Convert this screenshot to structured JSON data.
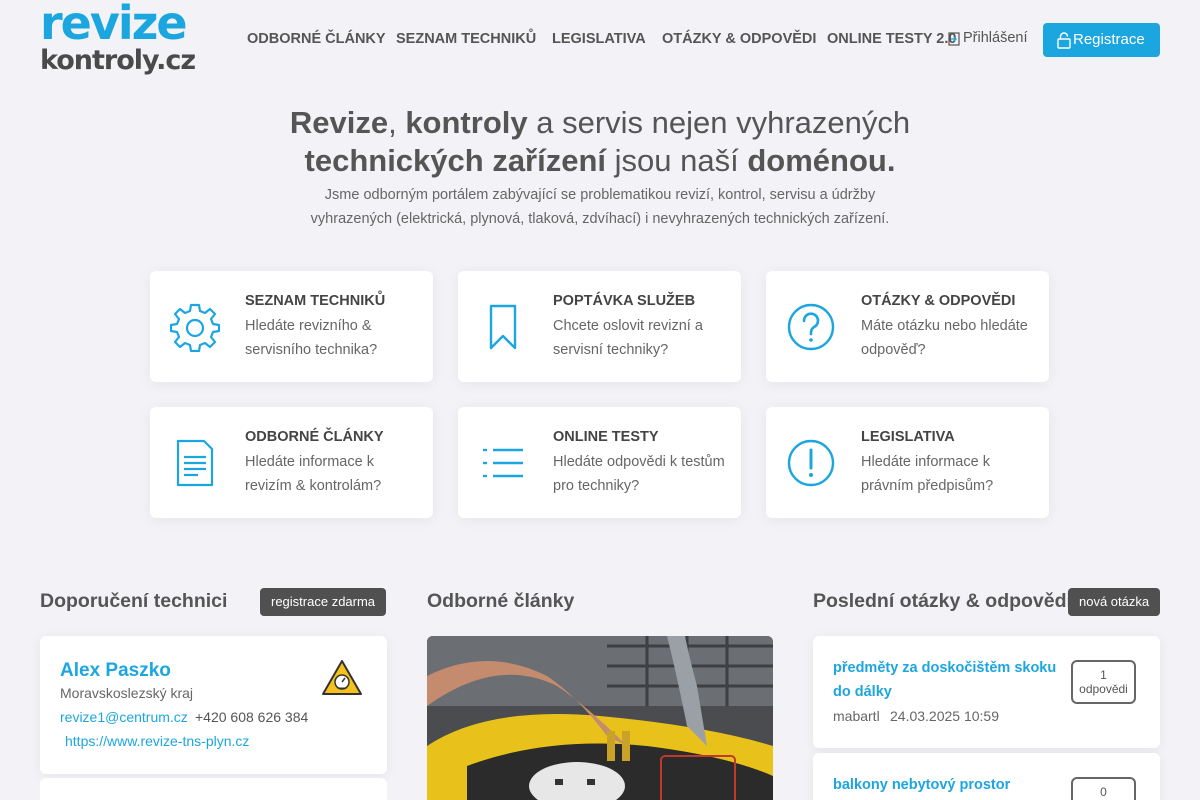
{
  "logo": {
    "line1": "revize",
    "line2": "kontroly.cz"
  },
  "nav": {
    "items": [
      {
        "label": "ODBORNÉ ČLÁNKY"
      },
      {
        "label": "SEZNAM TECHNIKŮ"
      },
      {
        "label": "LEGISLATIVA"
      },
      {
        "label": "OTÁZKY & ODPOVĚDI"
      },
      {
        "label": "ONLINE TESTY 2.0"
      }
    ],
    "login": "Přihlášení",
    "register": "Registrace"
  },
  "hero": {
    "title_parts": [
      "Revize",
      ", ",
      "kontroly",
      " a servis nejen vyhrazených",
      "technických zařízení",
      " jsou naší ",
      "doménou",
      "."
    ],
    "subtitle": "Jsme odborným portálem zabývající se problematikou revizí, kontrol, servisu a údržby vyhrazených (elektrická, plynová, tlaková, zdvíhací) i nevyhrazených technických zařízení."
  },
  "cards": [
    {
      "icon": "gear-icon",
      "title": "SEZNAM TECHNIKŮ",
      "desc": "Hledáte revizního & servisního technika?"
    },
    {
      "icon": "bookmark-icon",
      "title": "POPTÁVKA SLUŽEB",
      "desc": "Chcete oslovit revizní a servisní techniky?"
    },
    {
      "icon": "question-icon",
      "title": "OTÁZKY & ODPOVĚDI",
      "desc": "Máte otázku nebo hledáte odpověď?"
    },
    {
      "icon": "document-icon",
      "title": "ODBORNÉ ČLÁNKY",
      "desc": "Hledáte informace k revizím & kontrolám?"
    },
    {
      "icon": "list-icon",
      "title": "ONLINE TESTY",
      "desc": "Hledáte odpovědi k testům pro techniky?"
    },
    {
      "icon": "exclamation-icon",
      "title": "LEGISLATIVA",
      "desc": "Hledáte informace k právním předpisům?"
    }
  ],
  "sections": {
    "technicians": {
      "title": "Doporučení technici",
      "button": "registrace zdarma"
    },
    "articles": {
      "title": "Odborné články"
    },
    "qa": {
      "title": "Poslední otázky & odpovědi",
      "button": "nová otázka"
    }
  },
  "technician": {
    "name": "Alex Paszko",
    "region": "Moravskoslezský kraj",
    "email": "revize1@centrum.cz",
    "phone": "+420 608 626 384",
    "web": "https://www.revize-tns-plyn.cz",
    "badge_icon": "gas-warning-icon"
  },
  "questions": [
    {
      "title": "předměty za doskočištěm skoku do dálky",
      "author": "mabartl",
      "date": "24.03.2025 10:59",
      "count": "1",
      "count_label": "odpovědi"
    },
    {
      "title": "balkony nebytový prostor",
      "author": "",
      "date": "",
      "count": "0",
      "count_label": ""
    }
  ],
  "colors": {
    "accent": "#1ca6e0",
    "background": "#f3f3f7",
    "dark_pill": "#505050"
  }
}
